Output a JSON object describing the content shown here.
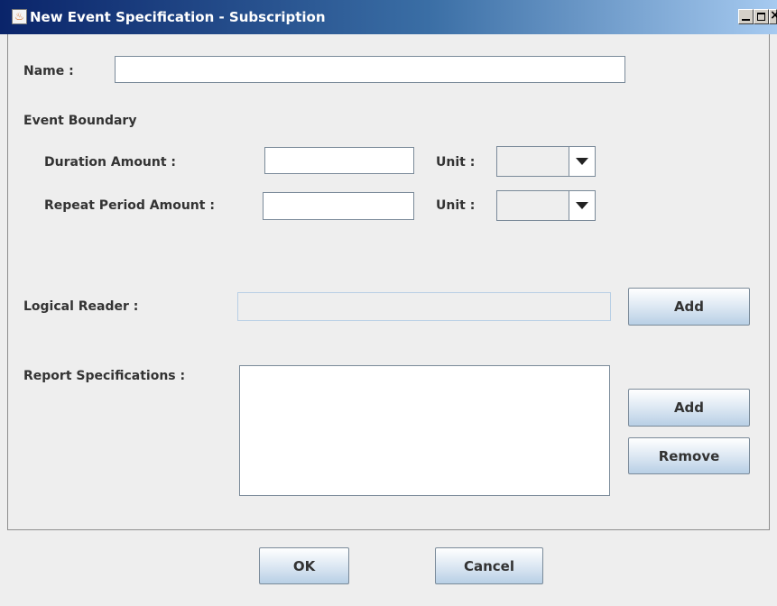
{
  "window": {
    "title": "New Event Specification - Subscription",
    "controls": {
      "close_glyph": "×"
    },
    "icon": "java-cup-icon"
  },
  "form": {
    "name_label": "Name :",
    "name_value": "",
    "event_boundary_label": "Event Boundary",
    "duration_amount_label": "Duration Amount :",
    "duration_amount_value": "",
    "duration_unit_label": "Unit :",
    "duration_unit_value": "",
    "repeat_period_label": "Repeat Period Amount :",
    "repeat_period_value": "",
    "repeat_unit_label": "Unit :",
    "repeat_unit_value": "",
    "logical_reader_label": "Logical Reader :",
    "logical_reader_value": "",
    "logical_reader_add": "Add",
    "report_specs_label": "Report Specifications :",
    "report_specs_items": [],
    "report_specs_add": "Add",
    "report_specs_remove": "Remove"
  },
  "footer": {
    "ok_label": "OK",
    "cancel_label": "Cancel"
  },
  "colors": {
    "titlebar_start": "#0a246a",
    "titlebar_end": "#a6caf0",
    "background": "#eeeeee",
    "button_gradient_bottom": "#b8cfe5"
  }
}
